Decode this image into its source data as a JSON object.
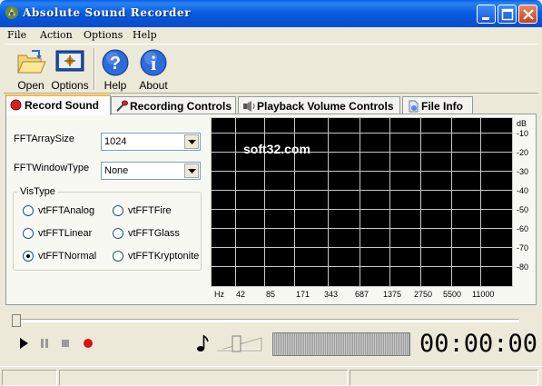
{
  "window": {
    "title": "Absolute Sound Recorder"
  },
  "menu": [
    "File",
    "Action",
    "Options",
    "Help"
  ],
  "toolbar": {
    "open": "Open",
    "options": "Options",
    "help": "Help",
    "about": "About"
  },
  "tabs": [
    "Record Sound",
    "Recording Controls",
    "Playback Volume Controls",
    "File Info"
  ],
  "record": {
    "fft_array_size_label": "FFTArraySize",
    "fft_array_size_value": "1024",
    "fft_window_type_label": "FFTWindowType",
    "fft_window_type_value": "None",
    "vistype_label": "VisType",
    "vistype_options": [
      "vtFFTAnalog",
      "vtFFTFire",
      "vtFFTLinear",
      "vtFFTGlass",
      "vtFFTNormal",
      "vtFFTKryptonite"
    ],
    "vistype_selected": "vtFFTNormal"
  },
  "spectrum": {
    "db_unit": "dB",
    "db_ticks": [
      "-10",
      "-20",
      "-30",
      "-40",
      "-50",
      "-60",
      "-70",
      "-80"
    ],
    "hz_unit": "Hz",
    "hz_ticks": [
      "42",
      "85",
      "171",
      "343",
      "687",
      "1375",
      "2750",
      "5500",
      "11000"
    ],
    "watermark": "soft32.com"
  },
  "player": {
    "timer": "00:00:00"
  }
}
